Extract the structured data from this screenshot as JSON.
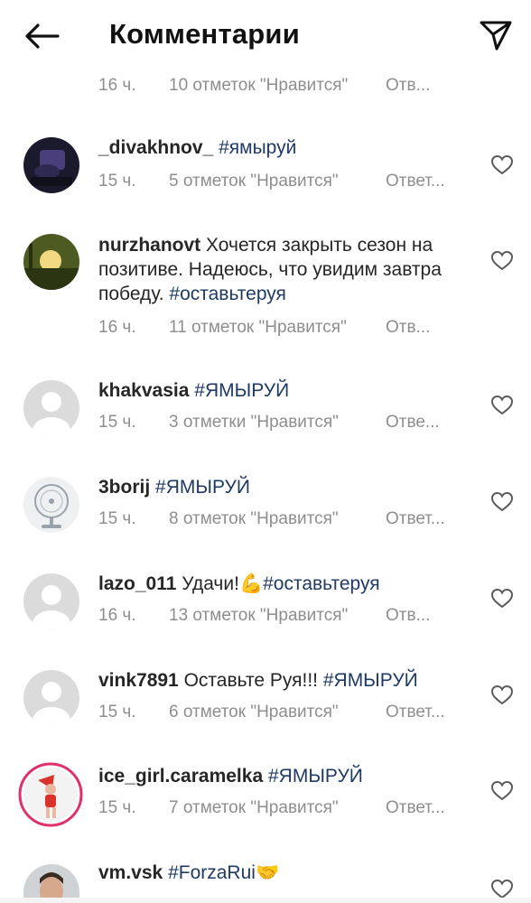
{
  "header": {
    "title": "Комментарии",
    "back_icon": "arrow-left-icon",
    "share_icon": "paper-plane-icon"
  },
  "top_meta": {
    "time": "16 ч.",
    "likes": "10 отметок \"Нравится\"",
    "reply": "Отв..."
  },
  "comments": [
    {
      "username": "_divakhnov_",
      "text": "",
      "hashtag": "#ямыруй",
      "emoji": "",
      "time": "15 ч.",
      "likes": "5 отметок \"Нравится\"",
      "reply": "Ответ..."
    },
    {
      "username": "nurzhanovt",
      "text": "Хочется закрыть сезон на позитиве. Надеюсь, что увидим завтра победу.",
      "hashtag": "#оставьтеруя",
      "emoji": "",
      "time": "16 ч.",
      "likes": "11 отметок \"Нравится\"",
      "reply": "Отв..."
    },
    {
      "username": "khakvasia",
      "text": "",
      "hashtag": "#ЯМЫРУЙ",
      "emoji": "",
      "time": "15 ч.",
      "likes": "3 отметки \"Нравится\"",
      "reply": "Отве..."
    },
    {
      "username": "3borij",
      "text": "",
      "hashtag": "#ЯМЫРУЙ",
      "emoji": "",
      "time": "15 ч.",
      "likes": "8 отметок \"Нравится\"",
      "reply": "Ответ..."
    },
    {
      "username": "lazo_011",
      "text": "Удачи!",
      "hashtag": "#оставьтеруя",
      "emoji": "💪",
      "time": "16 ч.",
      "likes": "13 отметок \"Нравится\"",
      "reply": "Отв..."
    },
    {
      "username": "vink7891",
      "text": "Оставьте Руя!!!",
      "hashtag": "#ЯМЫРУЙ",
      "emoji": "",
      "time": "15 ч.",
      "likes": "6 отметок \"Нравится\"",
      "reply": "Ответ..."
    },
    {
      "username": "ice_girl.caramelka",
      "text": "",
      "hashtag": "#ЯМЫРУЙ",
      "emoji": "",
      "time": "15 ч.",
      "likes": "7 отметок \"Нравится\"",
      "reply": "Ответ..."
    },
    {
      "username": "vm.vsk",
      "text": "",
      "hashtag": "#ForzaRui",
      "emoji": "🤝",
      "time": "",
      "likes": "",
      "reply": ""
    }
  ],
  "icons": {
    "like": "heart-outline-icon"
  },
  "colors": {
    "hashtag": "#1f3a64",
    "meta": "#8e8e8e",
    "text": "#262626",
    "story_ring": "#e1306c"
  }
}
